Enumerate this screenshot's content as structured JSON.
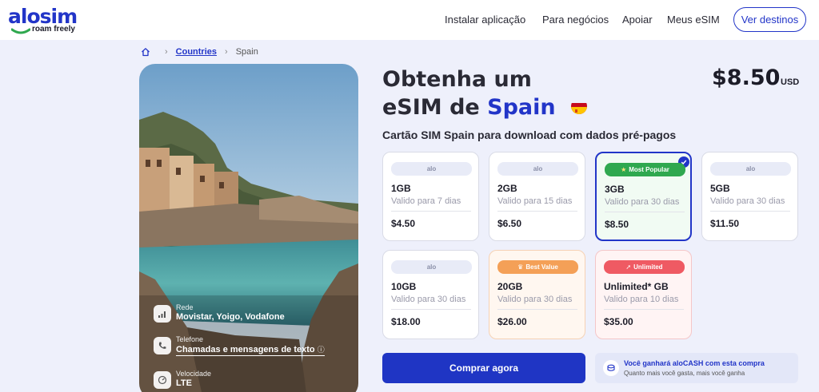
{
  "header": {
    "logo_word": "alosim",
    "logo_tagline": "roam freely",
    "nav": [
      "Instalar aplicação",
      "Para negócios",
      "Apoiar",
      "Meus eSIM"
    ],
    "cta": "Ver destinos"
  },
  "breadcrumb": {
    "home_icon": "home-icon",
    "items": [
      "Countries",
      "Spain"
    ]
  },
  "hero": {
    "network_label": "Rede",
    "network_value": "Movistar, Yoigo, Vodafone",
    "phone_label": "Telefone",
    "phone_value": "Chamadas e mensagens de texto",
    "speed_label": "Velocidade",
    "speed_value": "LTE"
  },
  "product": {
    "title_line1": "Obtenha um",
    "title_line2_prefix": "eSIM de",
    "country": "Spain",
    "price": "$8.50",
    "currency": "USD",
    "subtitle": "Cartão SIM Spain para download com dados pré-pagos"
  },
  "plans": [
    {
      "badge": "alo",
      "size": "1GB",
      "validity": "Valido para 7 dias",
      "price": "$4.50"
    },
    {
      "badge": "alo",
      "size": "2GB",
      "validity": "Valido para 15 dias",
      "price": "$6.50"
    },
    {
      "badge": "Most Popular",
      "size": "3GB",
      "validity": "Valido para 30 dias",
      "price": "$8.50"
    },
    {
      "badge": "alo",
      "size": "5GB",
      "validity": "Valido para 30 dias",
      "price": "$11.50"
    },
    {
      "badge": "alo",
      "size": "10GB",
      "validity": "Valido para 30 dias",
      "price": "$18.00"
    },
    {
      "badge": "Best Value",
      "size": "20GB",
      "validity": "Valido para 30 dias",
      "price": "$26.00"
    },
    {
      "badge": "Unlimited",
      "size": "Unlimited* GB",
      "validity": "Valido para 10 dias",
      "price": "$35.00"
    }
  ],
  "actions": {
    "buy": "Comprar agora",
    "cash_title": "Você ganhará aloCASH com esta compra",
    "cash_sub": "Quanto mais você gasta, mais você ganha"
  },
  "colors": {
    "brand": "#2235c8",
    "popular": "#2fa84f",
    "best_value": "#f4a057",
    "unlimited": "#ef5a63"
  }
}
